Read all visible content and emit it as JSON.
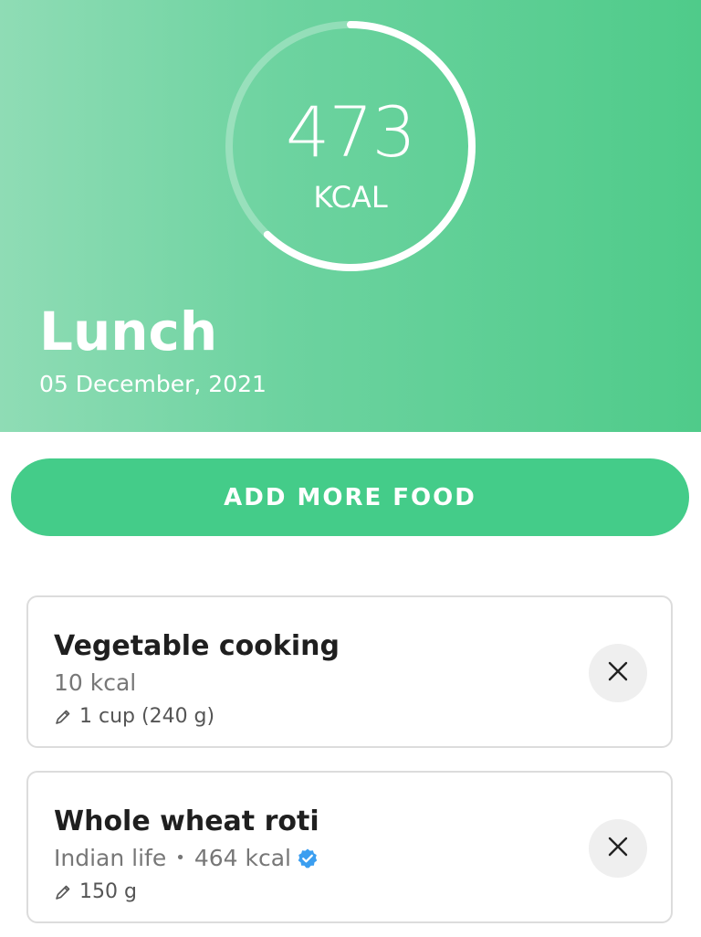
{
  "summary": {
    "calories": "473",
    "unit": "KCAL",
    "progress": 0.62
  },
  "meal": {
    "title": "Lunch",
    "date": "05 December, 2021"
  },
  "actions": {
    "add_more_food": "ADD MORE FOOD"
  },
  "foods": [
    {
      "name": "Vegetable cooking",
      "calories": "10 kcal",
      "portion": "1 cup (240 g)",
      "icons": [
        "pencil-icon",
        "close-icon"
      ]
    },
    {
      "name": "Whole wheat roti",
      "brand": "Indian life",
      "calories": "464 kcal",
      "verified": true,
      "portion": "150 g",
      "icons": [
        "verified-badge-icon",
        "pencil-icon",
        "close-icon"
      ]
    }
  ],
  "colors": {
    "accent": "#44cc89",
    "verified": "#3b9ef0",
    "card_border": "#dcdcdc"
  }
}
